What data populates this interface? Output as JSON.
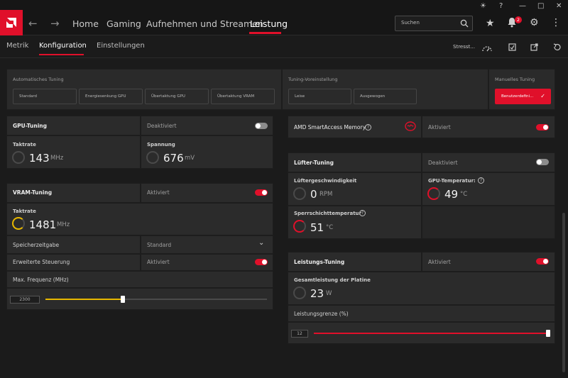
{
  "nav": {
    "items": [
      "Home",
      "Gaming",
      "Aufnehmen und Streamen",
      "Leistung"
    ],
    "active": "Leistung",
    "search_placeholder": "Suchen",
    "notification_count": "2"
  },
  "subnav": {
    "items": [
      "Metrik",
      "Konfiguration",
      "Einstellungen"
    ],
    "active": "Konfiguration",
    "stress_label": "Stresst..."
  },
  "auto_tuning": {
    "title": "Automatisches Tuning",
    "options": [
      "Standard",
      "Energiesenkung GPU",
      "Übertaktung GPU",
      "Übertaktung VRAM"
    ]
  },
  "preset": {
    "title": "Tuning-Voreinstellung",
    "options": [
      "Leise",
      "Ausgewogen"
    ]
  },
  "manual": {
    "title": "Manuelles Tuning",
    "button": "Benutzerdefini..."
  },
  "gpu_tuning": {
    "title": "GPU-Tuning",
    "state": "Deaktiviert",
    "enabled": false,
    "clock_label": "Taktrate",
    "clock_value": "143",
    "clock_unit": "MHz",
    "voltage_label": "Spannung",
    "voltage_value": "676",
    "voltage_unit": "mV"
  },
  "vram_tuning": {
    "title": "VRAM-Tuning",
    "state": "Aktiviert",
    "enabled": true,
    "clock_label": "Taktrate",
    "clock_value": "1481",
    "clock_unit": "MHz",
    "timing_label": "Speicherzeitgabe",
    "timing_value": "Standard",
    "advanced_label": "Erweiterte Steuerung",
    "advanced_state": "Aktiviert",
    "advanced_enabled": true,
    "maxfreq_label": "Max. Frequenz (MHz)",
    "maxfreq_value": "2300",
    "maxfreq_fraction": 0.35,
    "slider_color": "#e8b800"
  },
  "sam": {
    "title": "AMD SmartAccess Memory",
    "state": "Aktiviert",
    "enabled": true
  },
  "fan_tuning": {
    "title": "Lüfter-Tuning",
    "state": "Deaktiviert",
    "enabled": false,
    "speed_label": "Lüftergeschwindigkeit",
    "speed_value": "0",
    "speed_unit": "RPM",
    "gpu_temp_label": "GPU-Temperatur:",
    "gpu_temp_value": "49",
    "gpu_temp_unit": "°C",
    "junction_label": "Sperrschichttemperatur",
    "junction_value": "51",
    "junction_unit": "°C"
  },
  "power_tuning": {
    "title": "Leistungs-Tuning",
    "state": "Aktiviert",
    "enabled": true,
    "board_power_label": "Gesamtleistung der Platine",
    "board_power_value": "23",
    "board_power_unit": "W",
    "limit_label": "Leistungsgrenze (%)",
    "limit_value": "12",
    "limit_fraction": 1.0,
    "slider_color": "#e0102a"
  },
  "colors": {
    "accent": "#e0102a",
    "vram_accent": "#e8b800",
    "background": "#1b1b1b"
  }
}
